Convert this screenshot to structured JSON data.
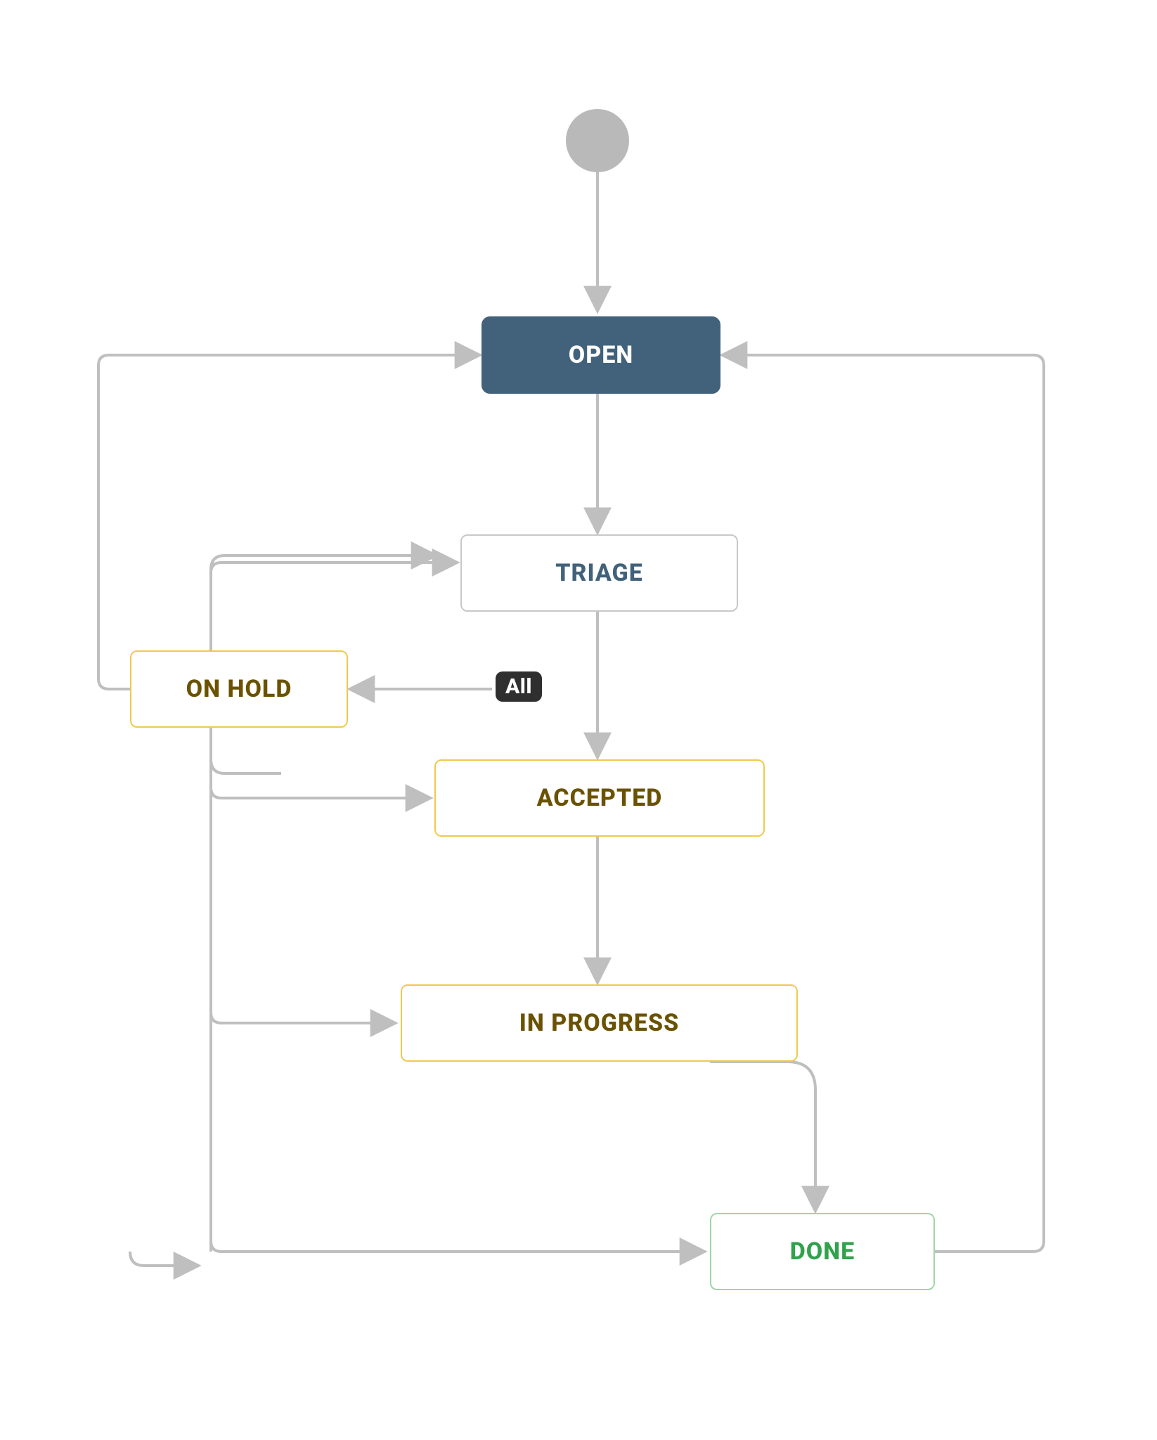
{
  "diagram": {
    "type": "workflow-state-diagram",
    "start_node": true,
    "nodes": {
      "open": {
        "label": "OPEN",
        "kind": "initial",
        "fill": "#41627a",
        "text": "#ffffff"
      },
      "triage": {
        "label": "TRIAGE",
        "kind": "neutral",
        "border": "#c8c8c8",
        "text": "#41627a"
      },
      "on_hold": {
        "label": "ON HOLD",
        "kind": "pending",
        "border": "#f0c94c",
        "text": "#6a5200"
      },
      "accepted": {
        "label": "ACCEPTED",
        "kind": "pending",
        "border": "#f0c94c",
        "text": "#6a5200"
      },
      "in_progress": {
        "label": "IN PROGRESS",
        "kind": "pending",
        "border": "#f0c94c",
        "text": "#6a5200"
      },
      "done": {
        "label": "DONE",
        "kind": "complete",
        "border": "#9fd6a8",
        "text": "#31a24c"
      }
    },
    "badges": {
      "all_transition": {
        "label": "All"
      }
    },
    "edges": [
      {
        "from": "start",
        "to": "open"
      },
      {
        "from": "open",
        "to": "triage"
      },
      {
        "from": "triage",
        "to": "accepted"
      },
      {
        "from": "accepted",
        "to": "in_progress"
      },
      {
        "from": "in_progress",
        "to": "done"
      },
      {
        "from": "all",
        "to": "on_hold",
        "badge": "all_transition"
      },
      {
        "from": "on_hold",
        "to": "triage"
      },
      {
        "from": "on_hold",
        "to": "accepted"
      },
      {
        "from": "on_hold",
        "to": "in_progress"
      },
      {
        "from": "on_hold",
        "to": "done"
      },
      {
        "from": "on_hold",
        "to": "open"
      },
      {
        "from": "done",
        "to": "open"
      }
    ],
    "colors": {
      "edge": "#bfbfbf",
      "background": "#ffffff"
    }
  }
}
